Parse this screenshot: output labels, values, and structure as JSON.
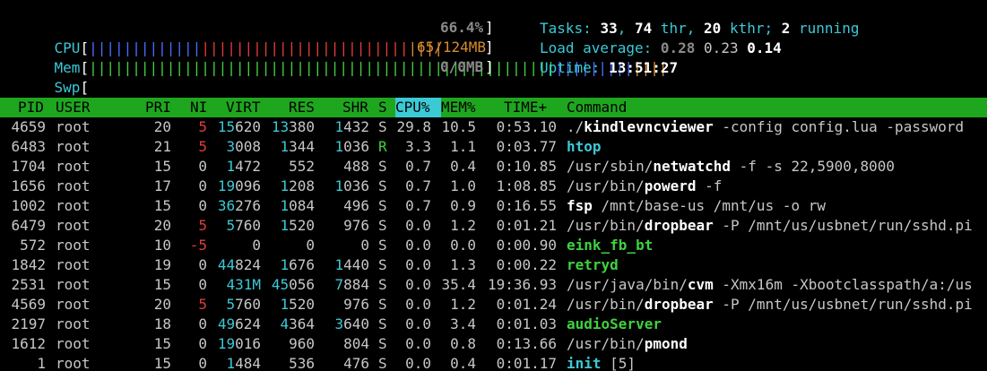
{
  "meters": {
    "cpu": {
      "label": "CPU",
      "value": "66.4%",
      "segments": [
        {
          "chars": "|||||||||||||",
          "color": "#4a6cff"
        },
        {
          "chars": "||||||||||||||||||||||||",
          "color": "#e23b3b"
        },
        {
          "chars": "||||",
          "color": "#d88c2a"
        }
      ]
    },
    "mem": {
      "label": "Mem",
      "value": "65/124MB",
      "segments": [
        {
          "chars": "||||||||||||||||||||||||||||||||||||||||||||||||||||||",
          "color": "#3fd13f"
        },
        {
          "chars": "|||||||||",
          "color": "#4a6cff"
        },
        {
          "chars": "||||",
          "color": "#d88c2a"
        }
      ]
    },
    "swp": {
      "label": "Swp",
      "value": "0/0MB",
      "segments": []
    }
  },
  "tasks": {
    "label": "Tasks:",
    "count": "33",
    "thr": "74",
    "thr_label": " thr,",
    "kthr": "20",
    "kthr_label": " kthr;",
    "running": "2",
    "running_label": " running"
  },
  "load": {
    "label": "Load average:",
    "l1": "0.28",
    "l5": "0.23",
    "l15": "0.14"
  },
  "uptime": {
    "label": "Uptime:",
    "value": "13:51:27"
  },
  "columns": {
    "pid": "PID",
    "user": "USER",
    "pri": "PRI",
    "ni": "NI",
    "virt": "VIRT",
    "res": "RES",
    "shr": "SHR",
    "s": "S",
    "cpu": "CPU%",
    "mem": "MEM%",
    "time": "TIME+",
    "command": "Command"
  },
  "processes": [
    {
      "pid": "4659",
      "user": "root",
      "pri": "20",
      "ni": "5",
      "virt": "15620",
      "res": "13380",
      "shr": "1432",
      "s": "S",
      "cpu": "29.8",
      "mem": "10.5",
      "time": "0:53.10",
      "cmd_pre": "./",
      "cmd_name": "kindlevncviewer",
      "cmd_args": " -config config.lua -password",
      "name_color": "#ffffff"
    },
    {
      "pid": "6483",
      "user": "root",
      "pri": "21",
      "ni": "5",
      "virt": "3008",
      "res": "1344",
      "shr": "1036",
      "s": "R",
      "cpu": "3.3",
      "mem": "1.1",
      "time": "0:03.77",
      "cmd_pre": "",
      "cmd_name": "htop",
      "cmd_args": "",
      "name_color": "#3cc9d6"
    },
    {
      "pid": "1704",
      "user": "root",
      "pri": "15",
      "ni": "0",
      "virt": "1472",
      "res": "552",
      "shr": "488",
      "s": "S",
      "cpu": "0.7",
      "mem": "0.4",
      "time": "0:10.85",
      "cmd_pre": "/usr/sbin/",
      "cmd_name": "netwatchd",
      "cmd_args": " -f -s 22,5900,8000",
      "name_color": "#ffffff"
    },
    {
      "pid": "1656",
      "user": "root",
      "pri": "17",
      "ni": "0",
      "virt": "19096",
      "res": "1208",
      "shr": "1036",
      "s": "S",
      "cpu": "0.7",
      "mem": "1.0",
      "time": "1:08.85",
      "cmd_pre": "/usr/bin/",
      "cmd_name": "powerd",
      "cmd_args": " -f",
      "name_color": "#ffffff"
    },
    {
      "pid": "1002",
      "user": "root",
      "pri": "15",
      "ni": "0",
      "virt": "36276",
      "res": "1084",
      "shr": "496",
      "s": "S",
      "cpu": "0.7",
      "mem": "0.9",
      "time": "0:16.55",
      "cmd_pre": "",
      "cmd_name": "fsp",
      "cmd_args": " /mnt/base-us /mnt/us -o rw",
      "name_color": "#ffffff"
    },
    {
      "pid": "6479",
      "user": "root",
      "pri": "20",
      "ni": "5",
      "virt": "5760",
      "res": "1520",
      "shr": "976",
      "s": "S",
      "cpu": "0.0",
      "mem": "1.2",
      "time": "0:01.21",
      "cmd_pre": "/usr/bin/",
      "cmd_name": "dropbear",
      "cmd_args": " -P /mnt/us/usbnet/run/sshd.pi",
      "name_color": "#ffffff"
    },
    {
      "pid": "572",
      "user": "root",
      "pri": "10",
      "ni": "-5",
      "virt": "0",
      "res": "0",
      "shr": "0",
      "s": "S",
      "cpu": "0.0",
      "mem": "0.0",
      "time": "0:00.90",
      "cmd_pre": "",
      "cmd_name": "eink_fb_bt",
      "cmd_args": "",
      "name_color": "#3fd13f"
    },
    {
      "pid": "1842",
      "user": "root",
      "pri": "19",
      "ni": "0",
      "virt": "44824",
      "res": "1676",
      "shr": "1440",
      "s": "S",
      "cpu": "0.0",
      "mem": "1.3",
      "time": "0:00.22",
      "cmd_pre": "",
      "cmd_name": "retryd",
      "cmd_args": "",
      "name_color": "#3fd13f"
    },
    {
      "pid": "2531",
      "user": "root",
      "pri": "15",
      "ni": "0",
      "virt": "431M",
      "res": "45056",
      "shr": "7884",
      "s": "S",
      "cpu": "0.0",
      "mem": "35.4",
      "time": "19:36.93",
      "cmd_pre": "/usr/java/bin/",
      "cmd_name": "cvm",
      "cmd_args": " -Xmx16m -Xbootclasspath/a:/us",
      "name_color": "#ffffff"
    },
    {
      "pid": "4569",
      "user": "root",
      "pri": "20",
      "ni": "5",
      "virt": "5760",
      "res": "1520",
      "shr": "976",
      "s": "S",
      "cpu": "0.0",
      "mem": "1.2",
      "time": "0:01.24",
      "cmd_pre": "/usr/bin/",
      "cmd_name": "dropbear",
      "cmd_args": " -P /mnt/us/usbnet/run/sshd.pi",
      "name_color": "#ffffff"
    },
    {
      "pid": "2197",
      "user": "root",
      "pri": "18",
      "ni": "0",
      "virt": "49624",
      "res": "4364",
      "shr": "3640",
      "s": "S",
      "cpu": "0.0",
      "mem": "3.4",
      "time": "0:01.03",
      "cmd_pre": "",
      "cmd_name": "audioServer",
      "cmd_args": "",
      "name_color": "#3fd13f"
    },
    {
      "pid": "1612",
      "user": "root",
      "pri": "15",
      "ni": "0",
      "virt": "19016",
      "res": "960",
      "shr": "804",
      "s": "S",
      "cpu": "0.0",
      "mem": "0.8",
      "time": "0:13.66",
      "cmd_pre": "/usr/bin/",
      "cmd_name": "pmond",
      "cmd_args": "",
      "name_color": "#ffffff"
    },
    {
      "pid": "1",
      "user": "root",
      "pri": "15",
      "ni": "0",
      "virt": "1484",
      "res": "536",
      "shr": "476",
      "s": "S",
      "cpu": "0.0",
      "mem": "0.4",
      "time": "0:01.17",
      "cmd_pre": "",
      "cmd_name": "init",
      "cmd_args": " [5]",
      "name_color": "#3cc9d6"
    }
  ]
}
